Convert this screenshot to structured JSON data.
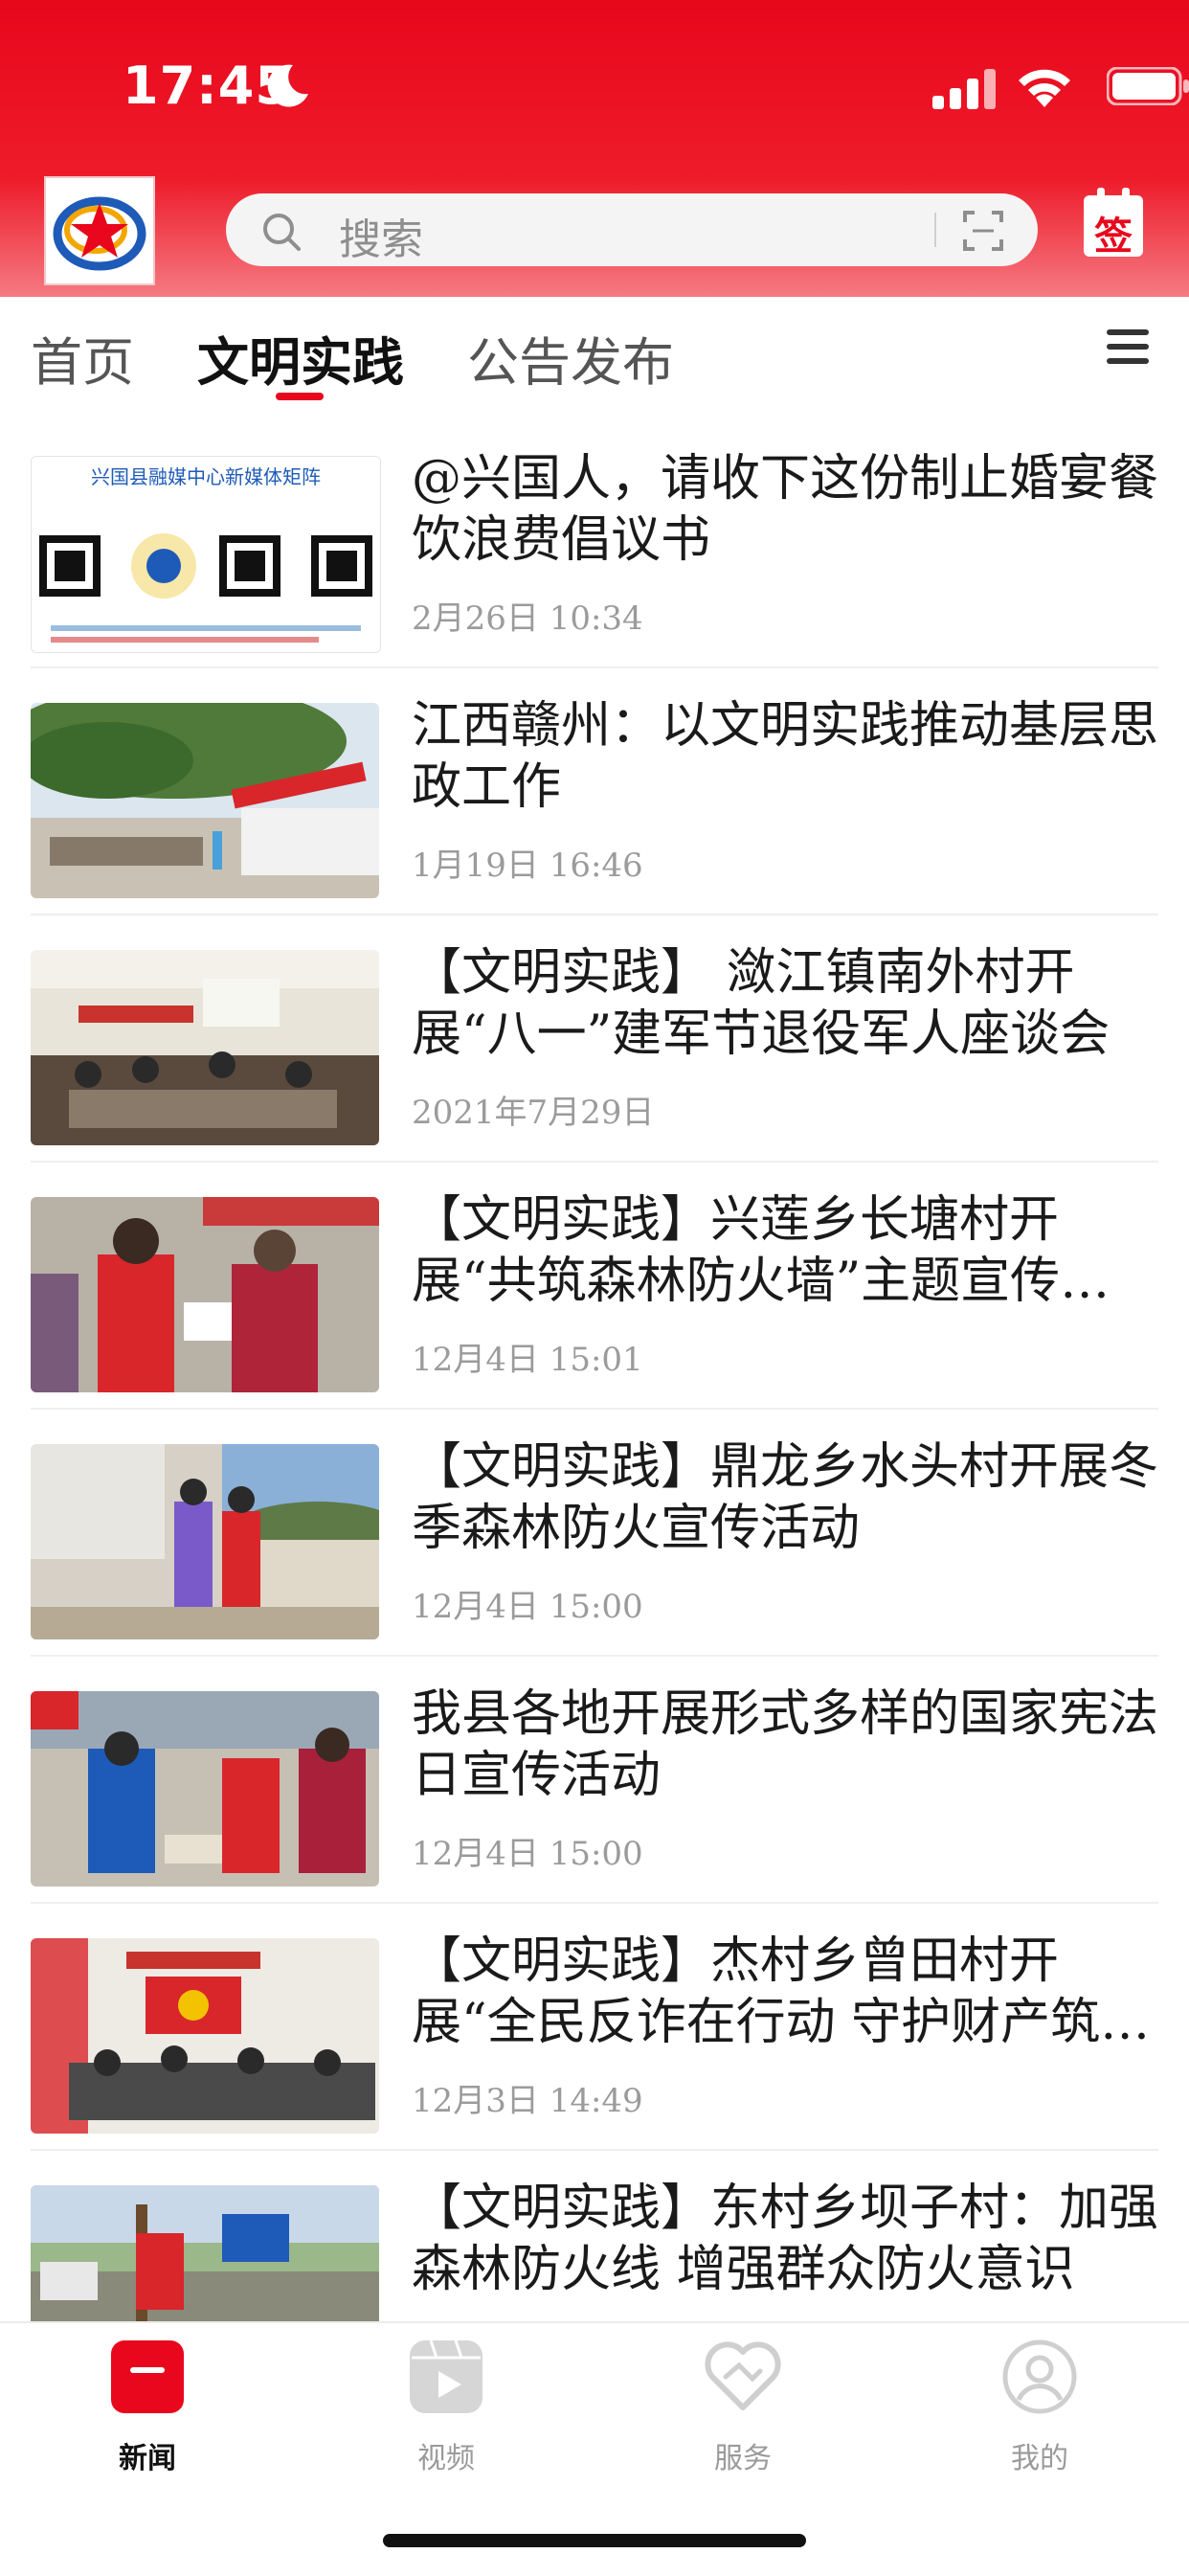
{
  "status_bar": {
    "time": "17:45"
  },
  "header": {
    "search_placeholder": "搜索",
    "sign_label": "签",
    "colors": {
      "brand_red": "#e8071c"
    }
  },
  "tabs": [
    {
      "label": "首页",
      "active": false
    },
    {
      "label": "文明实践",
      "active": true
    },
    {
      "label": "公告发布",
      "active": false
    }
  ],
  "news": [
    {
      "title": "@兴国人，请收下这份制止婚宴餐饮浪费倡议书",
      "date": "2月26日  10:34",
      "image": "poster-qr-codes"
    },
    {
      "title": "江西赣州：以文明实践推动基层思政工作",
      "date": "1月19日  16:46",
      "image": "outdoor-gathering"
    },
    {
      "title": "【文明实践】 潋江镇南外村开展“八一”建军节退役军人座谈会",
      "date": "2021年7月29日",
      "image": "meeting-room"
    },
    {
      "title": "【文明实践】兴莲乡长塘村开展“共筑森林防火墙”主题宣传活动",
      "date": "12月4日  15:01",
      "image": "volunteers-leaflets"
    },
    {
      "title": "【文明实践】鼎龙乡水头村开展冬季森林防火宣传活动",
      "date": "12月4日  15:00",
      "image": "village-visit"
    },
    {
      "title": "我县各地开展形式多样的国家宪法日宣传活动",
      "date": "12月4日  15:00",
      "image": "street-promotion"
    },
    {
      "title": "【文明实践】杰村乡曾田村开展“全民反诈在行动  守护财产筑防线”活动",
      "date": "12月3日  14:49",
      "image": "hall-lecture"
    },
    {
      "title": "【文明实践】东村乡坝子村：加强森林防火线  增强群众防火意识",
      "date": "",
      "image": "roadside-banner"
    }
  ],
  "bottom_nav": [
    {
      "label": "新闻",
      "icon": "news-icon",
      "active": true
    },
    {
      "label": "视频",
      "icon": "video-icon",
      "active": false
    },
    {
      "label": "服务",
      "icon": "service-icon",
      "active": false
    },
    {
      "label": "我的",
      "icon": "profile-icon",
      "active": false
    }
  ],
  "thumb_text": {
    "poster_title": "兴国县融媒中心新媒体矩阵"
  }
}
